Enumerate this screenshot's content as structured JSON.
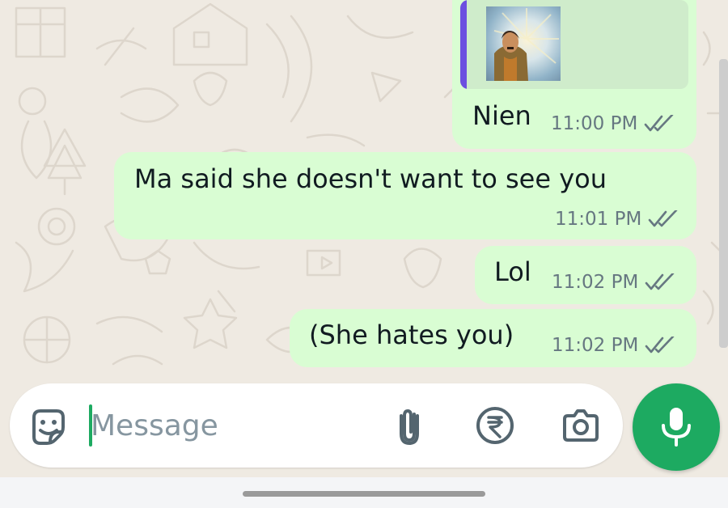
{
  "conversation": {
    "messages": [
      {
        "text": "Nien",
        "time": "11:00 PM",
        "status": "read",
        "has_image_reply": true
      },
      {
        "text": "Ma said she doesn't want to see you",
        "time": "11:01 PM",
        "status": "read"
      },
      {
        "text": "Lol",
        "time": "11:02 PM",
        "status": "read"
      },
      {
        "text": "(She hates you)",
        "time": "11:02 PM",
        "status": "read"
      }
    ]
  },
  "composer": {
    "placeholder": "Message",
    "emoji_icon": "sticker-icon",
    "attach_icon": "paperclip-icon",
    "payment_icon": "rupee-icon",
    "camera_icon": "camera-icon",
    "mic_icon": "microphone-icon"
  },
  "colors": {
    "outgoing_bubble": "#d9fdd3",
    "background": "#efeae2",
    "accent": "#1daa61",
    "quote_bar": "#6c4fe0",
    "meta_text": "#667781"
  }
}
